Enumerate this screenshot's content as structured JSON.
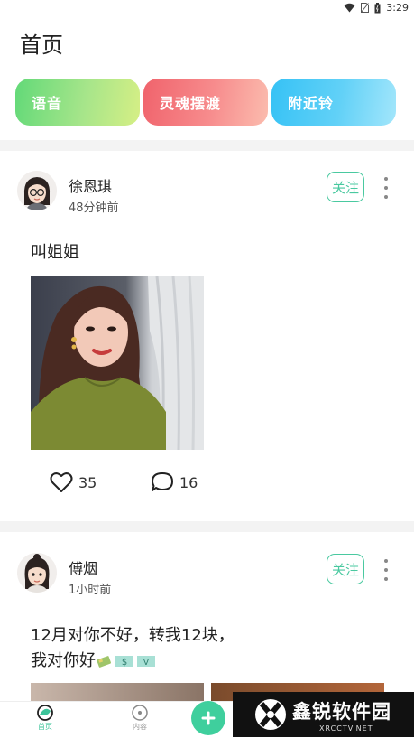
{
  "status_bar": {
    "time": "3:29",
    "icons": [
      "wifi-icon",
      "no-sim-icon",
      "battery-icon"
    ]
  },
  "page": {
    "title": "首页"
  },
  "chips": [
    {
      "label": "语音",
      "color": "#7cdc7e"
    },
    {
      "label": "灵魂摆渡",
      "color": "#f3777c"
    },
    {
      "label": "附近铃",
      "color": "#4cc9f6"
    }
  ],
  "posts": [
    {
      "user": "徐恩琪",
      "time": "48分钟前",
      "follow_label": "关注",
      "text": "叫姐姐",
      "likes": "35",
      "comments": "16"
    },
    {
      "user": "傅烟",
      "time": "1小时前",
      "follow_label": "关注",
      "text_line1": "12月对你不好，转我12块，",
      "text_line2": "我对你好"
    }
  ],
  "tabbar": {
    "tabs": [
      {
        "label": "首页",
        "icon": "home-icon"
      },
      {
        "label": "内容",
        "icon": "compass-icon"
      }
    ],
    "fab_icon": "plus-icon"
  },
  "watermark": {
    "text": "鑫锐软件园",
    "sub": "XRCCTV.NET"
  },
  "colors": {
    "accent": "#3fcf9d",
    "follow": "#4ac9a0"
  }
}
